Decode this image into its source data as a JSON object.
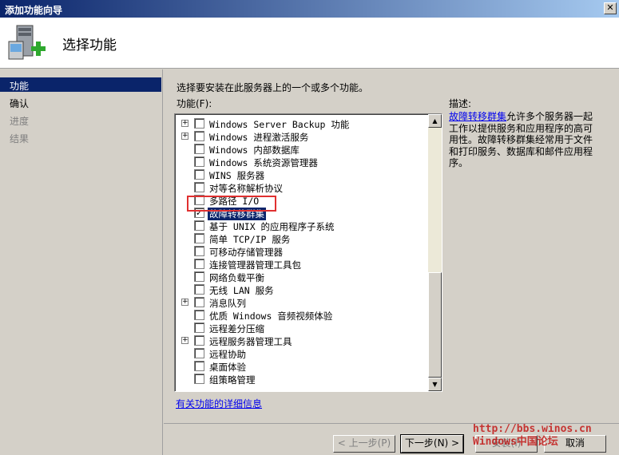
{
  "window": {
    "title": "添加功能向导",
    "close_glyph": "✕"
  },
  "header": {
    "title": "选择功能",
    "icon": "server-add-icon"
  },
  "nav": {
    "items": [
      {
        "label": "功能",
        "state": "active"
      },
      {
        "label": "确认",
        "state": "normal"
      },
      {
        "label": "进度",
        "state": "disabled"
      },
      {
        "label": "结果",
        "state": "disabled"
      }
    ]
  },
  "main": {
    "instruction": "选择要安装在此服务器上的一个或多个功能。",
    "features_label": "功能(F):",
    "description_label": "描述:",
    "description_link": "故障转移群集",
    "description_rest": "允许多个服务器一起工作以提供服务和应用程序的高可用性。故障转移群集经常用于文件和打印服务、数据库和邮件应用程序。",
    "more_info_link": "有关功能的详细信息",
    "features": [
      {
        "label": "Windows Server Backup 功能",
        "expandable": true,
        "checked": false
      },
      {
        "label": "Windows 进程激活服务",
        "expandable": true,
        "checked": false
      },
      {
        "label": "Windows 内部数据库",
        "expandable": false,
        "checked": false
      },
      {
        "label": "Windows 系统资源管理器",
        "expandable": false,
        "checked": false
      },
      {
        "label": "WINS 服务器",
        "expandable": false,
        "checked": false
      },
      {
        "label": "对等名称解析协议",
        "expandable": false,
        "checked": false
      },
      {
        "label": "多路径 I/O",
        "expandable": false,
        "checked": false
      },
      {
        "label": "故障转移群集",
        "expandable": false,
        "checked": true,
        "selected": true
      },
      {
        "label": "基于 UNIX 的应用程序子系统",
        "expandable": false,
        "checked": false
      },
      {
        "label": "简单 TCP/IP 服务",
        "expandable": false,
        "checked": false
      },
      {
        "label": "可移动存储管理器",
        "expandable": false,
        "checked": false
      },
      {
        "label": "连接管理器管理工具包",
        "expandable": false,
        "checked": false
      },
      {
        "label": "网络负载平衡",
        "expandable": false,
        "checked": false
      },
      {
        "label": "无线 LAN 服务",
        "expandable": false,
        "checked": false
      },
      {
        "label": "消息队列",
        "expandable": true,
        "checked": false
      },
      {
        "label": "优质 Windows 音频视频体验",
        "expandable": false,
        "checked": false
      },
      {
        "label": "远程差分压缩",
        "expandable": false,
        "checked": false
      },
      {
        "label": "远程服务器管理工具",
        "expandable": true,
        "checked": false
      },
      {
        "label": "远程协助",
        "expandable": false,
        "checked": false
      },
      {
        "label": "桌面体验",
        "expandable": false,
        "checked": false
      },
      {
        "label": "组策略管理",
        "expandable": false,
        "checked": false
      }
    ]
  },
  "footer": {
    "back_label": "< 上一步(P)",
    "next_label": "下一步(N) >",
    "install_label": "安装(I)",
    "cancel_label": "取消"
  },
  "watermark": {
    "line1": "http://bbs.winos.cn",
    "line2": "Windows中国论坛"
  },
  "colors": {
    "accent": "#0a246a",
    "highlight_box": "#e03030",
    "link": "#0000ee"
  }
}
